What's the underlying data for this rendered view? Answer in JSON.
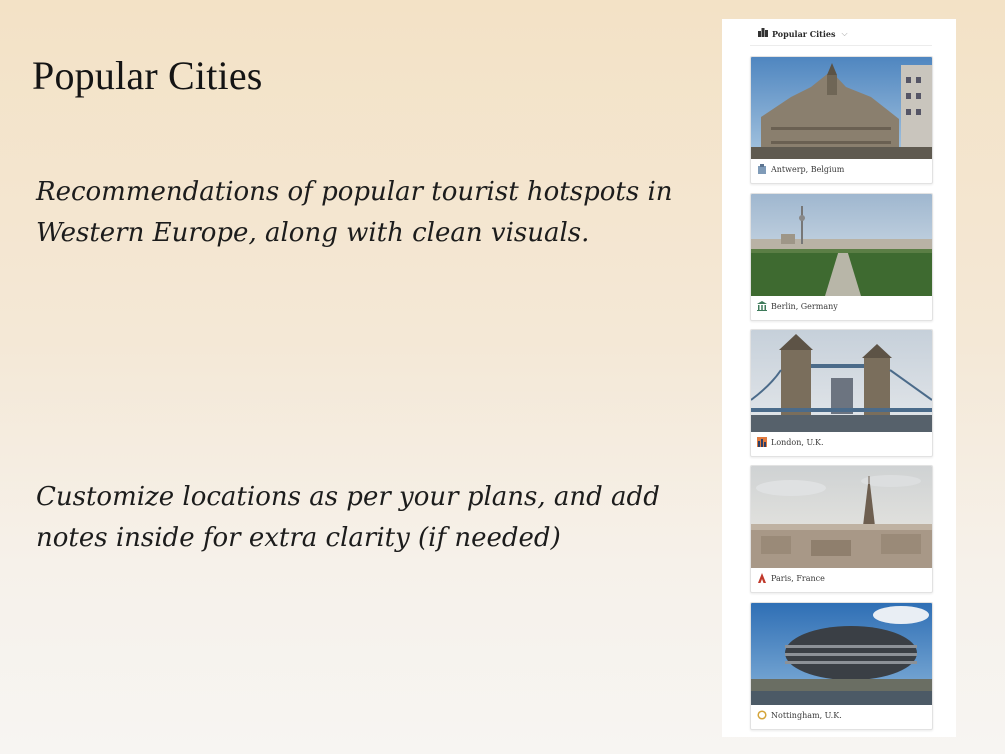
{
  "title": "Popular Cities",
  "paragraph1": "Recommendations of popular tourist hotspots in Western Europe, along with clean visuals.",
  "paragraph2": "Customize locations as per your plans, and add notes inside for extra clarity (if needed)",
  "panel": {
    "header": "Popular Cities",
    "header_icon": "city-skyline-icon",
    "cards": [
      {
        "label": "Antwerp, Belgium",
        "icon": "building-icon"
      },
      {
        "label": "Berlin, Germany",
        "icon": "classical-building-icon"
      },
      {
        "label": "London, U.K.",
        "icon": "cityscape-dusk-icon"
      },
      {
        "label": "Paris, France",
        "icon": "tower-icon"
      },
      {
        "label": "Nottingham, U.K.",
        "icon": "circle-icon"
      }
    ]
  }
}
